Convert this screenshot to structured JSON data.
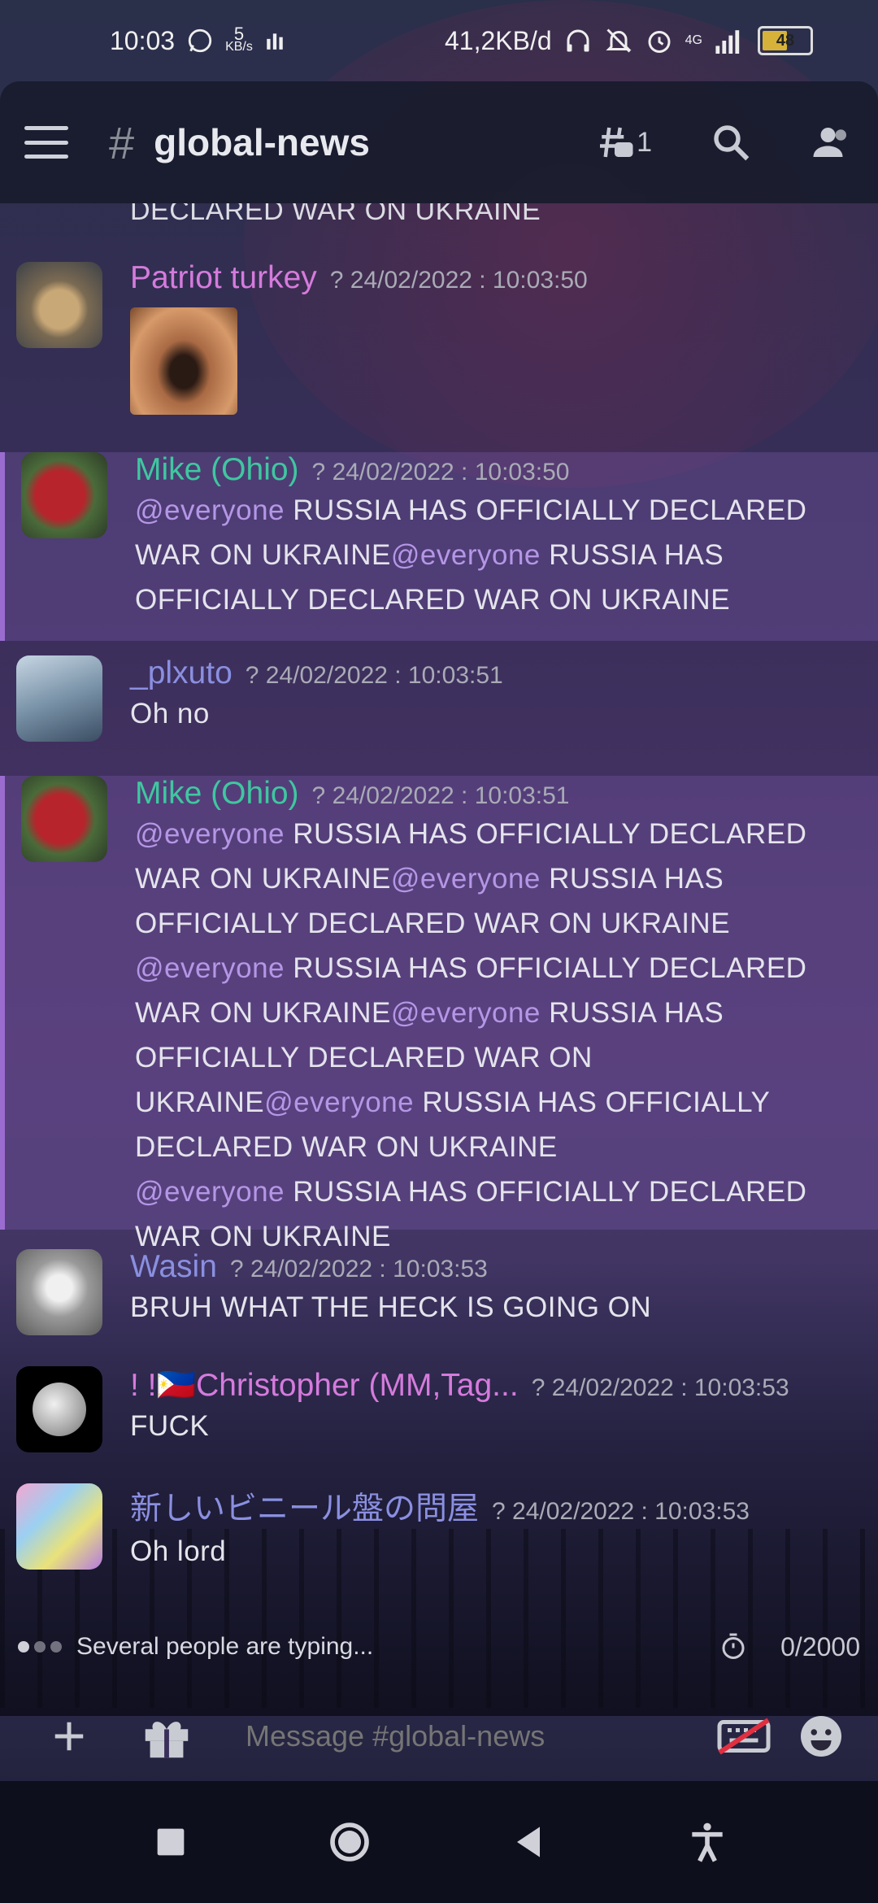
{
  "status_bar": {
    "time": "10:03",
    "net_speed_value": "5",
    "net_speed_unit": "KB/s",
    "data_usage": "41,2KB/d",
    "network": "4G",
    "battery": "48"
  },
  "header": {
    "channel_name": "global-news",
    "threads_count": "1"
  },
  "partial_text": "DECLARED WAR ON UKRAINE",
  "messages": [
    {
      "author": "Patriot turkey",
      "author_color": "#d57bdc",
      "timestamp": "? 24/02/2022 : 10:03:50"
    },
    {
      "author": "Mike (Ohio)",
      "author_color": "#3fc7a0",
      "timestamp": "? 24/02/2022 : 10:03:50",
      "seg1_at": "@everyone",
      "seg1": " RUSSIA HAS OFFICIALLY DECLARED WAR ON UKRAINE",
      "seg2_at": "@everyone",
      "seg2": " RUSSIA HAS OFFICIALLY DECLARED WAR ON UKRAINE"
    },
    {
      "author": "_plxuto",
      "author_color": "#8a8fe0",
      "timestamp": "? 24/02/2022 : 10:03:51",
      "text": "Oh no"
    },
    {
      "author": "Mike (Ohio)",
      "author_color": "#3fc7a0",
      "timestamp": "? 24/02/2022 : 10:03:51",
      "p1_at": "@everyone",
      "p1": " RUSSIA HAS OFFICIALLY DECLARED WAR ON UKRAINE",
      "p1b_at": "@everyone",
      "p1b": " RUSSIA HAS OFFICIALLY DECLARED WAR ON UKRAINE",
      "p2_at": "@everyone",
      "p2": " RUSSIA HAS OFFICIALLY DECLARED WAR ON UKRAINE",
      "p2b_at": "@everyone",
      "p2b": " RUSSIA HAS OFFICIALLY DECLARED WAR ON UKRAINE",
      "p2c_at": "@everyone",
      "p2c": " RUSSIA HAS OFFICIALLY DECLARED WAR ON UKRAINE",
      "p3_at": "@everyone",
      "p3": " RUSSIA HAS OFFICIALLY DECLARED WAR ON UKRAINE"
    },
    {
      "author": "Wasin",
      "author_color": "#8a8fe0",
      "timestamp": "? 24/02/2022 : 10:03:53",
      "text": "BRUH WHAT THE HECK IS GOING ON"
    },
    {
      "author": "! !🇵🇭Christopher (MM,Tag...",
      "author_color": "#d57bdc",
      "timestamp": "? 24/02/2022 : 10:03:53",
      "text": "FUCK"
    },
    {
      "author": "新しいビニール盤の問屋",
      "author_color": "#8a8fe0",
      "timestamp": "? 24/02/2022 : 10:03:53",
      "text": "Oh lord"
    }
  ],
  "typing": {
    "text": "Several people are typing...",
    "char_count": "0/2000"
  },
  "composer": {
    "placeholder": "Message #global-news"
  }
}
